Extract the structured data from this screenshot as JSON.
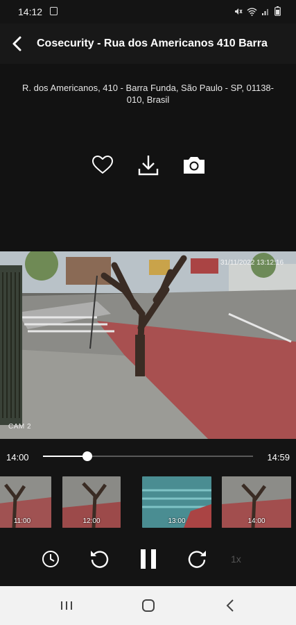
{
  "status_bar": {
    "time": "14:12",
    "icons": [
      "notification-icon",
      "mute-icon",
      "wifi-icon",
      "signal-icon",
      "battery-icon"
    ]
  },
  "header": {
    "back_icon": "back-arrow-icon",
    "title": "Cosecurity -  Rua dos Americanos 410 Barra"
  },
  "camera": {
    "address": "R. dos Americanos, 410 - Barra Funda, São Paulo - SP, 01138-010, Brasil",
    "actions": [
      {
        "name": "favorite",
        "icon": "heart-icon"
      },
      {
        "name": "download",
        "icon": "download-icon"
      },
      {
        "name": "snapshot",
        "icon": "camera-icon"
      }
    ],
    "overlay_label": "CAM 2",
    "overlay_timestamp": "31/11/2022 13:12:16"
  },
  "timeline": {
    "start": "14:00",
    "end": "14:59",
    "progress": 0.21
  },
  "thumbnails": [
    {
      "label": "11:00"
    },
    {
      "label": "12:00"
    },
    {
      "label": "13:00"
    },
    {
      "label": "14:00"
    }
  ],
  "controls": {
    "history_icon": "clock-icon",
    "rewind_icon": "rewind-icon",
    "pause_icon": "pause-icon",
    "forward_icon": "forward-icon",
    "speed": "1x"
  },
  "nav_bar": {
    "icons": [
      "recents-icon",
      "home-icon",
      "back-icon"
    ]
  },
  "colors": {
    "background": "#121212",
    "header": "#181818",
    "accent": "#ffffff",
    "muted": "#555555",
    "nav_bar": "#f2f2f2"
  }
}
